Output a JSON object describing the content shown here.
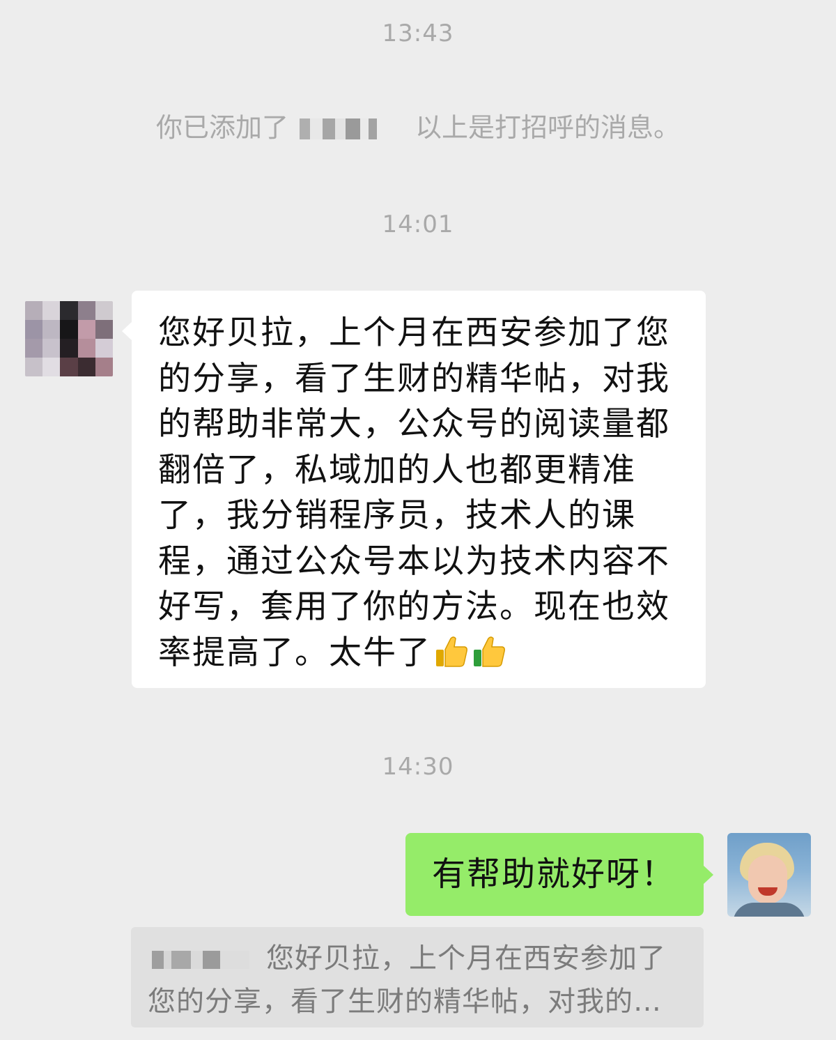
{
  "timestamps": [
    "13:43",
    "14:01",
    "14:30"
  ],
  "system_message": {
    "prefix": "你已添加了",
    "suffix": "以上是打招呼的消息。"
  },
  "incoming_message": {
    "lines": [
      "您好贝拉，上个月在西安参加了您",
      "的分享，看了生财的精华帖，对我",
      "的帮助非常大，公众号的阅读量都",
      "翻倍了，私域加的人也都更精准",
      "了，我分销程序员，技术人的课",
      "程，通过公众号本以为技术内容不",
      "好写，套用了你的方法。现在也效",
      "率提高了。太牛了"
    ],
    "emoji": [
      "thumbs-up-icon",
      "thumbs-up-icon"
    ]
  },
  "outgoing_message": {
    "text": "有帮助就好呀！"
  },
  "quoted_message": {
    "line1": "您好贝拉，上个月在西安参加了",
    "line2": "您的分享，看了生财的精华帖，对我的…"
  },
  "colors": {
    "background": "#ededed",
    "incoming_bubble": "#ffffff",
    "outgoing_bubble": "#95ec69",
    "quote_background": "#e0e0e0",
    "meta_text": "#a9a9a9"
  }
}
